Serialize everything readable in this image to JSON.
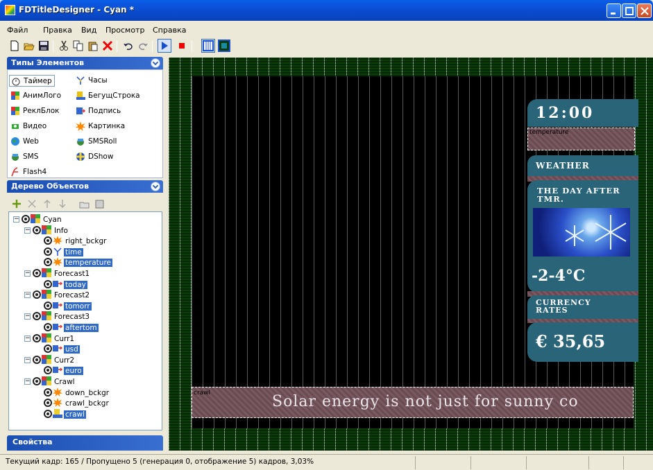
{
  "window": {
    "title": "FDTitleDesigner - Cyan *"
  },
  "menu": [
    "Файл",
    "Правка",
    "Вид",
    "Просмотр",
    "Справка"
  ],
  "toolbar_icons": [
    "new-icon",
    "open-icon",
    "save-icon",
    "cut-icon",
    "copy-icon",
    "paste-icon",
    "delete-icon",
    "undo-icon",
    "redo-icon",
    "play-icon",
    "stop-icon",
    "view-grid-icon",
    "view-fill-icon"
  ],
  "types_panel": {
    "title": "Типы Элементов",
    "items": [
      {
        "label": "Таймер",
        "icon": "stopwatch-icon"
      },
      {
        "label": "Часы",
        "icon": "clock-icon"
      },
      {
        "label": "АнимЛого",
        "icon": "anim-logo-icon"
      },
      {
        "label": "БегущСтрока",
        "icon": "crawl-icon"
      },
      {
        "label": "РеклБлок",
        "icon": "ad-block-icon"
      },
      {
        "label": "Подпись",
        "icon": "caption-icon"
      },
      {
        "label": "Видео",
        "icon": "video-icon"
      },
      {
        "label": "Картинка",
        "icon": "picture-icon"
      },
      {
        "label": "Web",
        "icon": "web-icon"
      },
      {
        "label": "SMSRoll",
        "icon": "sms-roll-icon"
      },
      {
        "label": "SMS",
        "icon": "sms-icon"
      },
      {
        "label": "DShow",
        "icon": "dshow-icon"
      },
      {
        "label": "Flash4",
        "icon": "flash-icon"
      }
    ]
  },
  "tree_panel": {
    "title": "Дерево Объектов",
    "nodes": [
      {
        "label": "Cyan",
        "selected": false
      },
      {
        "label": "Info",
        "selected": false
      },
      {
        "label": "right_bckgr",
        "selected": false
      },
      {
        "label": "time",
        "selected": true
      },
      {
        "label": "temperature",
        "selected": true
      },
      {
        "label": "Forecast1",
        "selected": false
      },
      {
        "label": "today",
        "selected": true
      },
      {
        "label": "Forecast2",
        "selected": false
      },
      {
        "label": "tomorr",
        "selected": true
      },
      {
        "label": "Forecast3",
        "selected": false
      },
      {
        "label": "aftertom",
        "selected": true
      },
      {
        "label": "Curr1",
        "selected": false
      },
      {
        "label": "usd",
        "selected": true
      },
      {
        "label": "Curr2",
        "selected": false
      },
      {
        "label": "euro",
        "selected": true
      },
      {
        "label": "Crawl",
        "selected": false
      },
      {
        "label": "down_bckgr",
        "selected": false
      },
      {
        "label": "crawl_bckgr",
        "selected": false
      },
      {
        "label": "crawl",
        "selected": true
      }
    ]
  },
  "props_panel": {
    "title": "Свойства"
  },
  "preview": {
    "time": "12:00",
    "temperature_label": "temperature",
    "weather": "WEATHER",
    "day_after": "THE DAY AFTER TMR.",
    "temp_value": "-2-4°C",
    "currency_title": "CURRENCY RATES",
    "currency_value": "€ 35,65",
    "crawl_label": "crawl",
    "crawl_text": "Solar energy is not just for sunny co"
  },
  "status": {
    "text": "Текущий кадр: 165 / Пропущено 5 (генерация 0, отображение 5) кадров,  3,03%"
  }
}
